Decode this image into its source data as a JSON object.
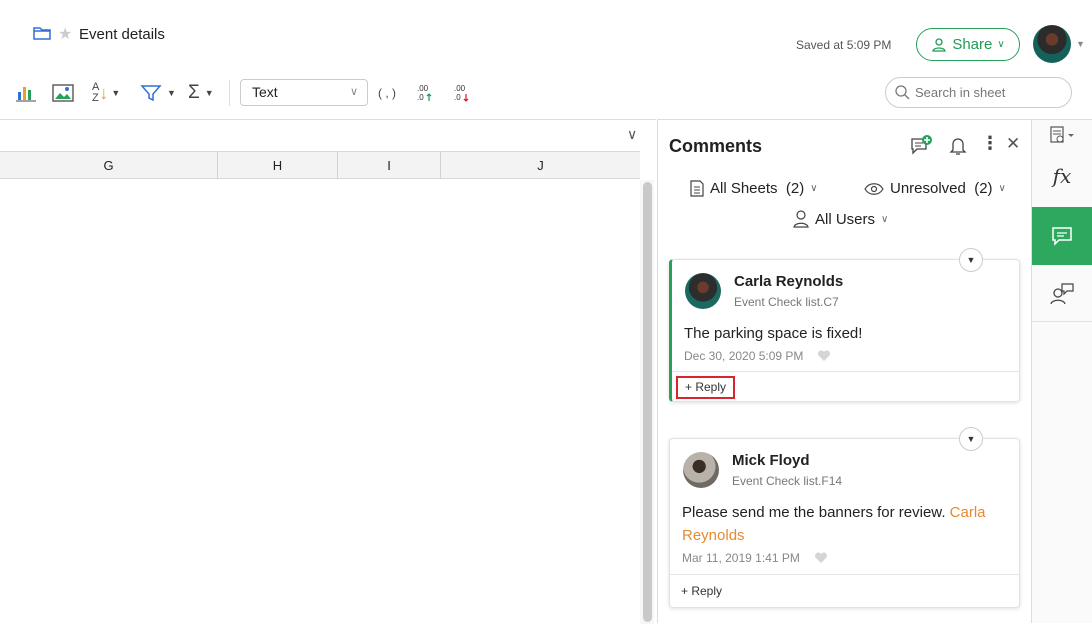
{
  "header": {
    "title": "Event details",
    "saved_text": "Saved at 5:09 PM",
    "share_label": "Share"
  },
  "toolbar": {
    "format_value": "Text",
    "thousands_sep": "( , )",
    "search_placeholder": "Search in sheet"
  },
  "sheet": {
    "columns": [
      "G",
      "H",
      "I",
      "J"
    ]
  },
  "comments_panel": {
    "title": "Comments",
    "filters": {
      "sheets": "All Sheets  (2)",
      "status": "Unresolved  (2)",
      "users": "All Users"
    },
    "comments": [
      {
        "author": "Carla Reynolds",
        "ref": "Event Check list.C7",
        "text": "The parking space is fixed!",
        "mention": "",
        "date": "Dec 30, 2020 5:09 PM",
        "reply_label": "+ Reply"
      },
      {
        "author": "Mick Floyd",
        "ref": "Event Check list.F14",
        "text": "Please send me the banners for review.",
        "mention": "Carla Reynolds",
        "date": "Mar 11, 2019 1:41 PM",
        "reply_label": "+ Reply"
      }
    ]
  },
  "colors": {
    "accent": "#27a05a",
    "mention": "#e58a2f",
    "highlight": "#d8262e"
  }
}
